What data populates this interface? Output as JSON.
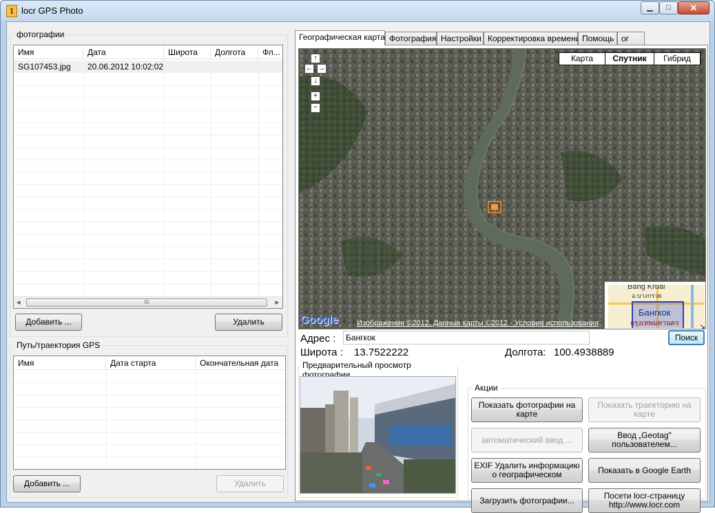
{
  "window": {
    "title": "locr GPS Photo",
    "minimize_glyph": "▁",
    "maximize_glyph": "□",
    "close_glyph": "✕"
  },
  "photos": {
    "group_title": "фотографии",
    "columns": [
      "Имя",
      "Дата",
      "Широта",
      "Долгота",
      "Фл..."
    ],
    "rows": [
      {
        "name": "SG107453.jpg",
        "date": "20.06.2012 10:02:02",
        "lat": "",
        "lon": "",
        "fl": ""
      }
    ],
    "scroll_left": "◂",
    "scroll_right": "▸",
    "scroll_grip": "III",
    "add_button": "Добавить ...",
    "delete_button": "Удалить"
  },
  "track": {
    "group_title": "Путь/траектория GPS",
    "columns": [
      "Имя",
      "Дата старта",
      "Окончательная дата"
    ],
    "add_button": "Добавить ...",
    "delete_button": "Удалить"
  },
  "tabs": [
    "Географическая карта",
    "Фотография",
    "Настройки",
    "Корректировка времени",
    "Помощь",
    "or"
  ],
  "map": {
    "types": [
      "Карта",
      "Спутник",
      "Гибрид"
    ],
    "active_type": "Спутник",
    "nav": {
      "up": "↑",
      "left": "←",
      "right": "→",
      "down": "↓",
      "zoom_in": "+",
      "zoom_out": "−"
    },
    "google_logo": "Google",
    "attribution": "Изображения ©2012, Данные карты ©2012 - Условия использования",
    "overview": {
      "label_top": "Bang Kruai",
      "label_top_thai": "อ.บางกรวย",
      "city": "Бангкок",
      "city_thai": "กรุงเทพมหานคร",
      "corner_glyph": "↘"
    }
  },
  "address": {
    "label": "Адрес :",
    "value": "Бангкок",
    "search_button": "Поиск"
  },
  "coords": {
    "lat_label": "Широта :",
    "lat_value": "13.7522222",
    "lon_label": "Долгота:",
    "lon_value": "100.4938889"
  },
  "preview": {
    "group_title": "Предварительный просмотр фотографии"
  },
  "actions": {
    "group_title": "Акции",
    "show_photos_on_map": "Показать фотографии на карте",
    "show_track_on_map": "Показать траекторию на карте",
    "auto_input": "автоматический ввод ...",
    "geotag_input": "Ввод „Geotag\" пользователем...",
    "exif_delete": "EXIF Удалить информацию о географическом",
    "google_earth": "Показать в Google Earth",
    "upload_photos": "Загрузить фотографии...",
    "visit_locr": "Посети locr-страницу http://www.locr.com"
  },
  "colors": {
    "accent_blue": "#3c7fb1",
    "selected_row": "#f0f0f0",
    "disabled_text": "#a0a0a0"
  }
}
